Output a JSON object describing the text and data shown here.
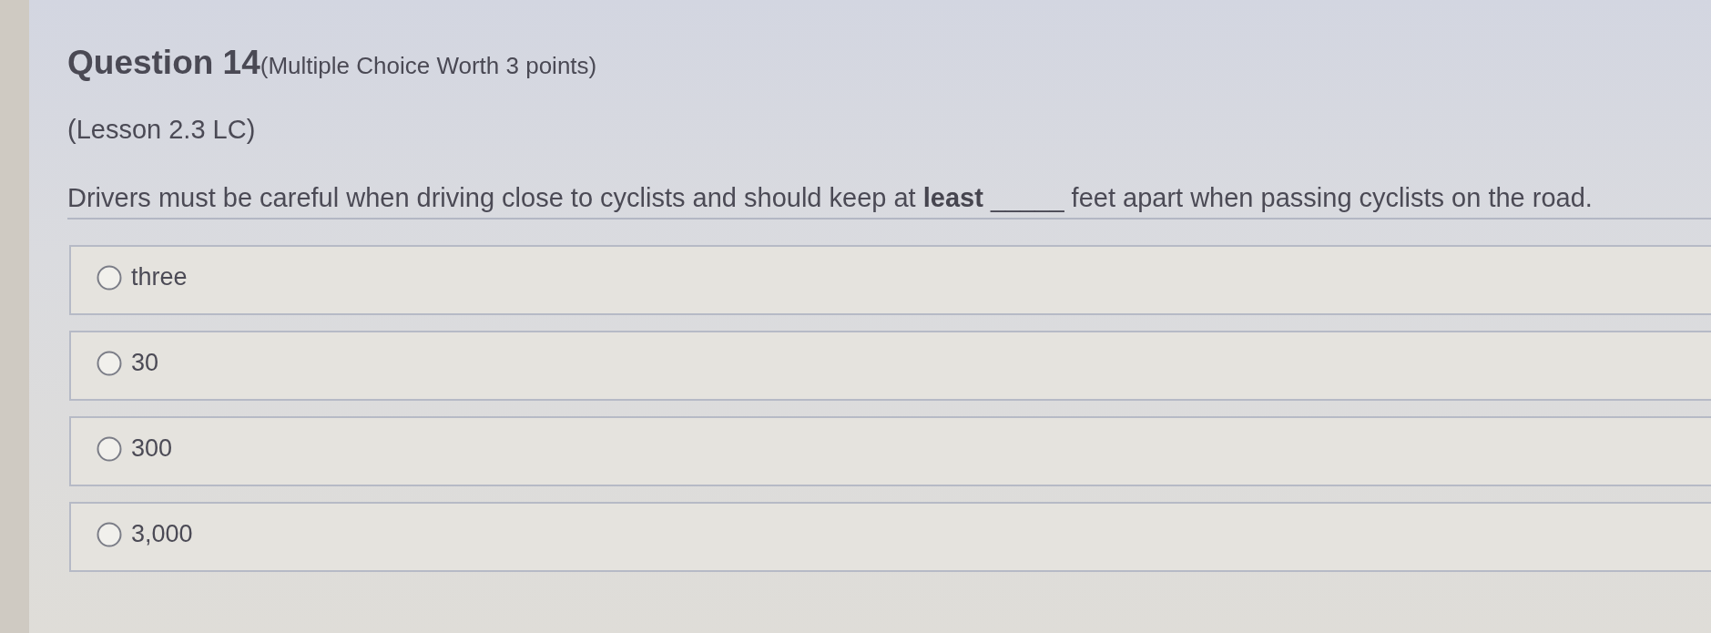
{
  "question": {
    "title": "Question 14",
    "type_label": "(Multiple Choice Worth 3 points)",
    "lesson": "(Lesson 2.3 LC)",
    "prompt": "Drivers must be careful when driving close to cyclists and should keep at **least** _____ feet apart when passing cyclists on the road."
  },
  "options": [
    {
      "label": "three",
      "selected": false
    },
    {
      "label": "30",
      "selected": false
    },
    {
      "label": "300",
      "selected": false
    },
    {
      "label": "3,000",
      "selected": false
    }
  ]
}
